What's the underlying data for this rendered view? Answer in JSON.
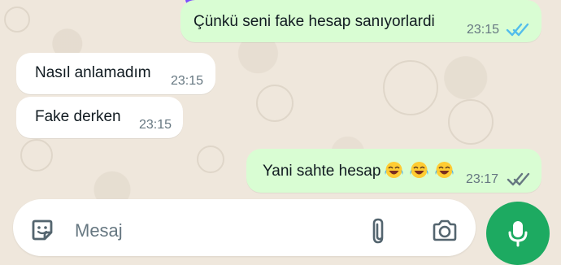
{
  "messages": [
    {
      "direction": "outgoing",
      "text": "Çünkü seni fake hesap sanıyorlardi",
      "time": "23:15",
      "status": "read"
    },
    {
      "direction": "incoming",
      "text": "Nasıl anlamadım",
      "time": "23:15"
    },
    {
      "direction": "incoming",
      "text": "Fake derken",
      "time": "23:15"
    },
    {
      "direction": "outgoing",
      "text": "Yani sahte hesap",
      "emoji": [
        "😂",
        "😂",
        "😂"
      ],
      "time": "23:17",
      "status": "delivered"
    }
  ],
  "composer": {
    "placeholder": "Mesaj",
    "icons": {
      "sticker": "sticker-icon",
      "attach": "paperclip-icon",
      "camera": "camera-icon",
      "mic": "microphone-icon"
    }
  },
  "colors": {
    "background": "#efe7dc",
    "incoming_bubble": "#ffffff",
    "outgoing_bubble": "#d9fdd3",
    "read_ticks": "#53bdeb",
    "delivered_ticks": "#667781",
    "mic_button": "#1daa61",
    "purple_accent": "#7c4dff"
  }
}
